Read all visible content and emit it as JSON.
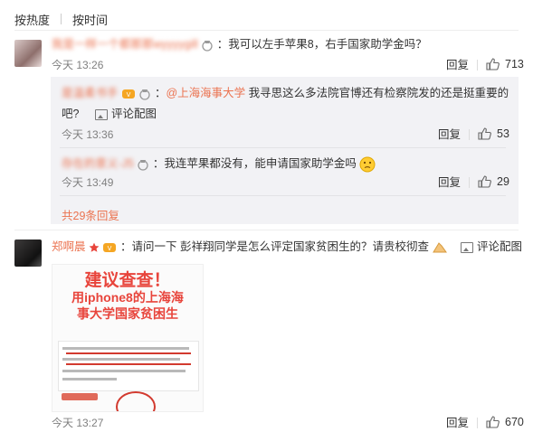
{
  "sort": {
    "hot": "按热度",
    "time": "按时间"
  },
  "comment1": {
    "username": "我是一样一个都那那wyyyygill",
    "separator": "：",
    "text": "我可以左手苹果8，右手国家助学金吗？",
    "time": "今天 13:26",
    "reply_label": "回复",
    "likes": "713"
  },
  "reply1": {
    "username": "是温柔书手",
    "separator": "：",
    "mention": "@上海海事大学",
    "text_line1": " 我寻思这么多法院官博还有检察院发的还是挺重要的",
    "text_line2": "吧?",
    "pic_label": "评论配图",
    "time": "今天 13:36",
    "reply_label": "回复",
    "likes": "53"
  },
  "reply2": {
    "username": "存在的意义-J5",
    "separator": "：",
    "text": "我连苹果都没有，能申请国家助学金吗",
    "time": "今天 13:49",
    "reply_label": "回复",
    "likes": "29"
  },
  "more_replies": "共29条回复",
  "comment2": {
    "username": "郑啊晨",
    "separator": "：",
    "text": "请问一下 彭祥翔同学是怎么评定国家贫困生的？请贵校彻查",
    "pic_label": "评论配图",
    "time": "今天 13:27",
    "reply_label": "回复",
    "likes": "670",
    "photo_title": "建议查查！",
    "photo_sub_line1": "用iphone8的上海海",
    "photo_sub_line2": "事大学国家贫困生"
  },
  "colors": {
    "username": "#eb7350",
    "link": "#eb7350",
    "reply_bg": "#f2f2f5"
  },
  "icons": [
    "badge-icon",
    "vip-icon",
    "thumb-up-icon",
    "image-icon",
    "emoji-icon",
    "star-icon"
  ]
}
